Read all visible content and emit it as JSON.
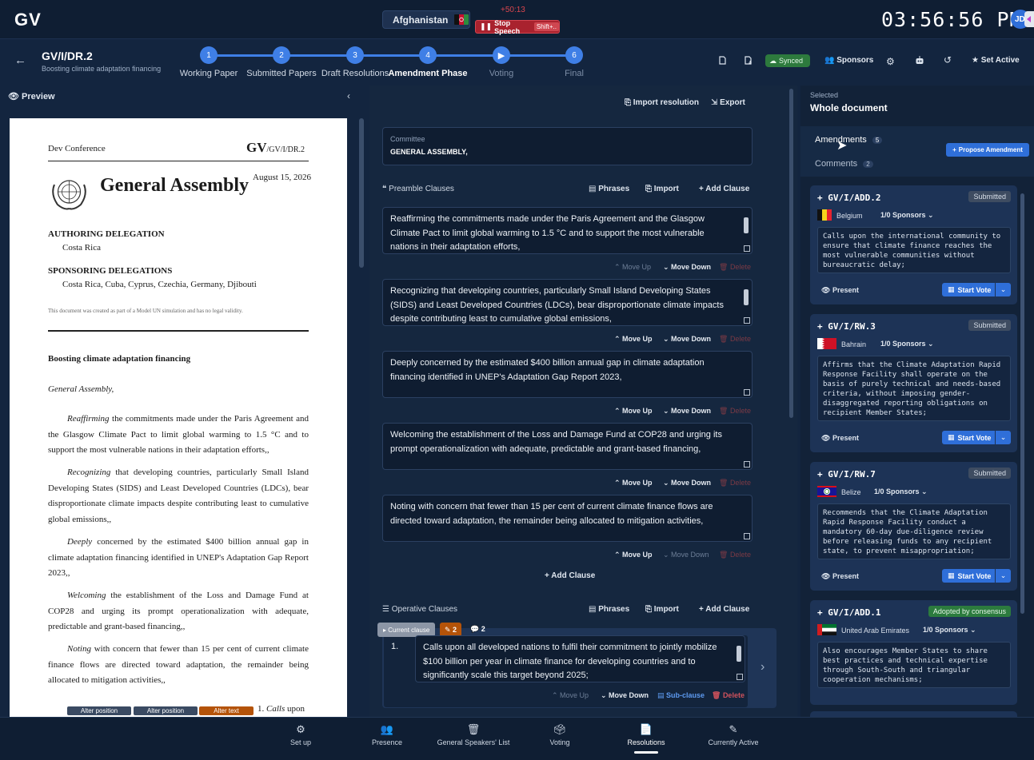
{
  "app": {
    "logo": "GV"
  },
  "topbar": {
    "country": "Afghanistan",
    "timer": "+50:13",
    "stop_speech": "Stop Speech",
    "stop_shortcut": "Shift+..",
    "clock": "03:56:56 PM",
    "avatar_initials": "JD"
  },
  "document": {
    "code": "GV/I/DR.2",
    "subtitle": "Boosting climate adaptation financing",
    "back_glyph": "←"
  },
  "steps": [
    {
      "num": "1",
      "label": "Working Paper"
    },
    {
      "num": "2",
      "label": "Submitted Papers"
    },
    {
      "num": "3",
      "label": "Draft Resolutions"
    },
    {
      "num": "4",
      "label": "Amendment Phase"
    },
    {
      "num": "▶",
      "label": "Voting"
    },
    {
      "num": "6",
      "label": "Final"
    }
  ],
  "header_actions": {
    "synced": "Synced",
    "sponsors": "Sponsors",
    "set_active": "Set Active"
  },
  "preview": {
    "title": "Preview",
    "conference": "Dev Conference",
    "code_big": "GV",
    "code_small": "/GV/I/DR.2",
    "organ": "General Assembly",
    "date": "August 15, 2026",
    "authoring_label": "AUTHORING DELEGATION",
    "authoring": "Costa Rica",
    "sponsoring_label": "SPONSORING DELEGATIONS",
    "sponsoring": "Costa Rica, Cuba, Cyprus, Czechia, Germany, Djibouti",
    "disclaimer": "This document was created as part of a Model UN simulation and has no legal validity.",
    "doc_title": "Boosting climate adaptation financing",
    "committee_line": "General Assembly,",
    "clauses": [
      {
        "lead": "Reaffirming",
        "rest": " the commitments made under the Paris Agreement and the Glasgow Climate Pact to limit global warming to 1.5 °C and to support the most vulnerable nations in their adaptation efforts,,"
      },
      {
        "lead": "Recognizing",
        "rest": " that developing countries, particularly Small Island Developing States (SIDS) and Least Developed Countries (LDCs), bear disproportionate climate impacts despite contributing least to cumulative global emissions,,"
      },
      {
        "lead": "Deeply",
        "rest": " concerned by the estimated $400 billion annual gap in climate adaptation financing identified in UNEP's Adaptation Gap Report 2023,,"
      },
      {
        "lead": "Welcoming",
        "rest": " the establishment of the Loss and Damage Fund at COP28 and urging its prompt operationalization with adequate, predictable and grant-based financing,,"
      },
      {
        "lead": "Noting",
        "rest": " with concern that fewer than 15 per cent of current climate finance flows are directed toward adaptation, the remainder being allocated to mitigation activities,,"
      }
    ],
    "tags": [
      "Alter position",
      "Alter position",
      "Alter text"
    ],
    "op_start_num": "1.",
    "op_start_lead": "Calls",
    "op_start_rest": " upon"
  },
  "editor": {
    "import_resolution": "Import resolution",
    "export": "Export",
    "committee_label": "Committee",
    "committee_value": "GENERAL ASSEMBLY,",
    "preamble_title": "Preamble Clauses",
    "phrases": "Phrases",
    "import": "Import",
    "add_clause": "Add Clause",
    "move_up": "Move Up",
    "move_down": "Move Down",
    "delete": "Delete",
    "preamble": [
      "Reaffirming the commitments made under the Paris Agreement and the Glasgow Climate Pact to limit global warming to 1.5 °C and to support the most vulnerable nations in their adaptation efforts,",
      "Recognizing that developing countries, particularly Small Island Developing States (SIDS) and Least Developed Countries (LDCs), bear disproportionate climate impacts despite contributing least to cumulative global emissions,",
      "Deeply concerned by the estimated $400 billion annual gap in climate adaptation financing identified in UNEP's Adaptation Gap Report 2023,",
      "Welcoming the establishment of the Loss and Damage Fund at COP28 and urging its prompt operationalization with adequate, predictable and grant-based financing,",
      "Noting with concern that fewer than 15 per cent of current climate finance flows are directed toward adaptation, the remainder being allocated to mitigation activities,"
    ],
    "operative_title": "Operative Clauses",
    "current_clause": "Current clause",
    "amend_count": "2",
    "comment_count": "2",
    "op_num": "1.",
    "op_text": "Calls upon all developed nations to fulfil their commitment to jointly mobilize $100 billion per year in climate finance for developing countries and to significantly scale this target beyond 2025;",
    "sub_clause": "Sub-clause"
  },
  "right": {
    "selected_label": "Selected",
    "selected_value": "Whole document",
    "tab_amendments": "Amendments",
    "amend_total": "5",
    "tab_comments": "Comments",
    "comment_total": "2",
    "propose": "Propose Amendment",
    "present": "Present",
    "start_vote": "Start Vote",
    "amendments": [
      {
        "code": "GV/I/ADD.2",
        "status": "Submitted",
        "country": "Belgium",
        "sponsors": "1/0 Sponsors",
        "text": "Calls upon the international community to ensure that climate finance reaches the most vulnerable communities without bureaucratic delay;"
      },
      {
        "code": "GV/I/RW.3",
        "status": "Submitted",
        "country": "Bahrain",
        "sponsors": "1/0 Sponsors",
        "text": "Affirms that the Climate Adaptation Rapid Response Facility shall operate on the basis of purely technical and needs-based criteria, without imposing gender-disaggregated reporting obligations on recipient Member States;"
      },
      {
        "code": "GV/I/RW.7",
        "status": "Submitted",
        "country": "Belize",
        "sponsors": "1/0 Sponsors",
        "text": "Recommends that the Climate Adaptation Rapid Response Facility conduct a mandatory 60-day due-diligence review before releasing funds to any recipient state, to prevent misappropriation;"
      },
      {
        "code": "GV/I/ADD.1",
        "status": "Adopted by consensus",
        "country": "United Arab Emirates",
        "sponsors": "1/0 Sponsors",
        "text": "Also encourages Member States to share best practices and technical expertise through South-South and triangular cooperation mechanisms;"
      }
    ]
  },
  "bottom_nav": [
    {
      "label": "Set up",
      "icon": "⚙"
    },
    {
      "label": "Presence",
      "icon": "👥"
    },
    {
      "label": "General Speakers' List",
      "icon": "🗑"
    },
    {
      "label": "Voting",
      "icon": "🗳"
    },
    {
      "label": "Resolutions",
      "icon": "📄"
    },
    {
      "label": "Currently Active",
      "icon": "✎"
    }
  ]
}
